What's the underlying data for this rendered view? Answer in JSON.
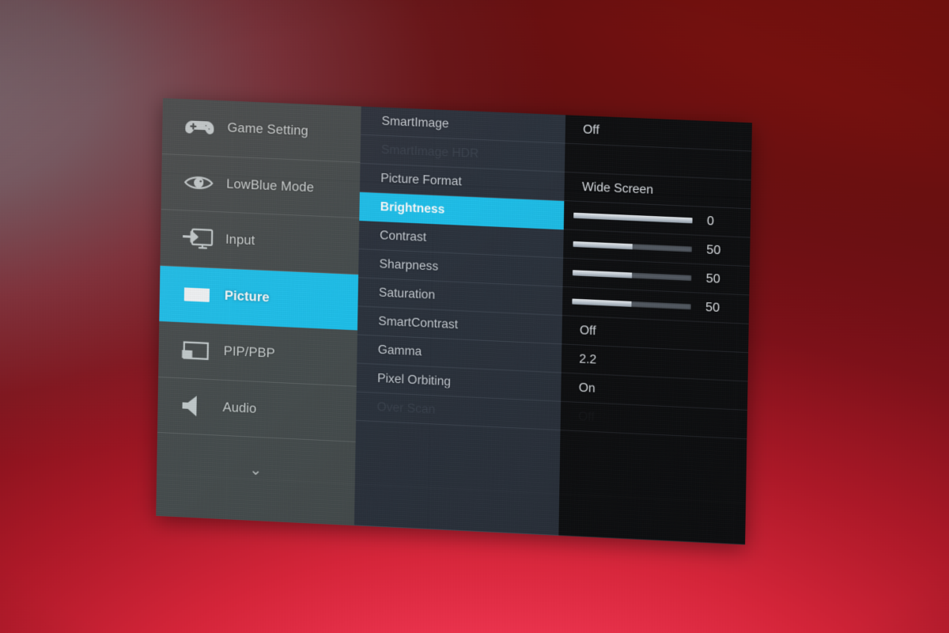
{
  "background": {
    "description": "photographed monitor screen, red gradient wallpaper",
    "colors": {
      "top_left": "#776a72",
      "top_right": "#7a1310",
      "left_middle": "#a15864",
      "bottom_center": "#ed3352"
    }
  },
  "osd": {
    "panel_bg": "#1a1b1d",
    "accent": "#17c2f0",
    "sidebar_bg": "#454c4d",
    "options_bg": "#2a313c",
    "values_bg": "#0c0d0f",
    "sidebar": {
      "items": [
        {
          "label": "Game Setting",
          "icon": "gamepad-icon",
          "active": false
        },
        {
          "label": "LowBlue Mode",
          "icon": "eye-icon",
          "active": false
        },
        {
          "label": "Input",
          "icon": "input-monitor-icon",
          "active": false
        },
        {
          "label": "Picture",
          "icon": "picture-icon",
          "active": true
        },
        {
          "label": "PIP/PBP",
          "icon": "pip-pbp-icon",
          "active": false
        },
        {
          "label": "Audio",
          "icon": "speaker-icon",
          "active": false
        }
      ],
      "scroll_indicator": "⌄"
    },
    "options": [
      {
        "label": "SmartImage",
        "value": "Off",
        "type": "text",
        "active": false,
        "disabled": false
      },
      {
        "label": "SmartImage HDR",
        "value": "",
        "type": "text",
        "active": false,
        "disabled": true
      },
      {
        "label": "Picture Format",
        "value": "Wide Screen",
        "type": "text",
        "active": false,
        "disabled": false
      },
      {
        "label": "Brightness",
        "value": "0",
        "type": "slider",
        "percent": 100,
        "active": true,
        "disabled": false
      },
      {
        "label": "Contrast",
        "value": "50",
        "type": "slider",
        "percent": 50,
        "active": false,
        "disabled": false
      },
      {
        "label": "Sharpness",
        "value": "50",
        "type": "slider",
        "percent": 50,
        "active": false,
        "disabled": false
      },
      {
        "label": "Saturation",
        "value": "50",
        "type": "slider",
        "percent": 50,
        "active": false,
        "disabled": false
      },
      {
        "label": "SmartContrast",
        "value": "Off",
        "type": "text",
        "active": false,
        "disabled": false
      },
      {
        "label": "Gamma",
        "value": "2.2",
        "type": "text",
        "active": false,
        "disabled": false
      },
      {
        "label": "Pixel Orbiting",
        "value": "On",
        "type": "text",
        "active": false,
        "disabled": false
      },
      {
        "label": "Over Scan",
        "value": "Off",
        "type": "text",
        "active": false,
        "disabled": true
      }
    ]
  }
}
